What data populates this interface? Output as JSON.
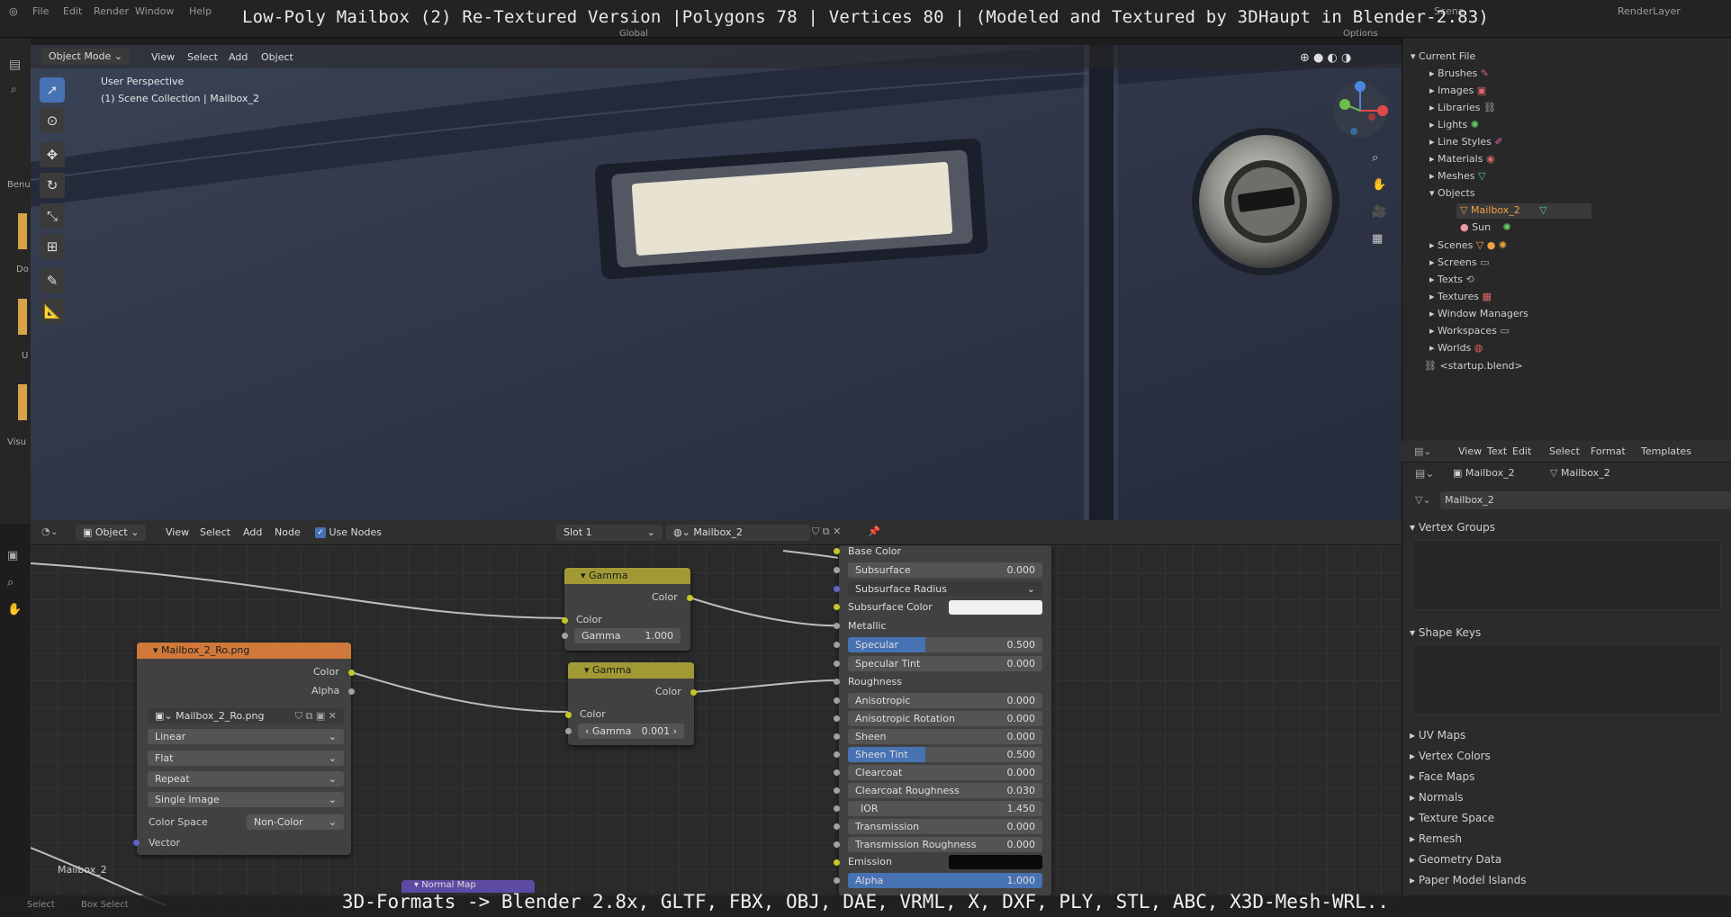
{
  "overlay_title": "Low-Poly Mailbox (2) Re-Textured Version |Polygons 78 | Vertices 80 | (Modeled and Textured by 3DHaupt in Blender-2.83)",
  "overlay_footer": "3D-Formats -> Blender 2.8x, GLTF, FBX, OBJ, DAE, VRML, X, DXF, PLY, STL, ABC, X3D-Mesh-WRL..",
  "topbar": {
    "menus": [
      "File",
      "Edit",
      "Render",
      "Window",
      "Help"
    ],
    "scene": "Scene",
    "render_layer": "RenderLayer",
    "options": "Options",
    "orientation": "Global"
  },
  "left_edge": {
    "labels": [
      "Benu",
      "Do",
      "U",
      "Visu"
    ]
  },
  "viewport": {
    "mode": "Object Mode",
    "menus": [
      "View",
      "Select",
      "Add",
      "Object"
    ],
    "overlay_line1": "User Perspective",
    "overlay_line2": "(1) Scene Collection | Mailbox_2"
  },
  "outliner": {
    "root": "Current File",
    "items": [
      "Brushes",
      "Images",
      "Libraries",
      "Lights",
      "Line Styles",
      "Materials",
      "Meshes",
      "Objects",
      "Scenes",
      "Screens",
      "Texts",
      "Textures",
      "Window Managers",
      "Workspaces",
      "Worlds"
    ],
    "objects_children": [
      "Mailbox_2",
      "Sun"
    ],
    "startup": "<startup.blend>"
  },
  "properties": {
    "menus": [
      "View",
      "Text",
      "Edit",
      "Select",
      "Format",
      "Templates"
    ],
    "object_name": "Mailbox_2",
    "mesh_name": "Mailbox_2",
    "data_name": "Mailbox_2",
    "panels_open": [
      "Vertex Groups",
      "Shape Keys"
    ],
    "panels_closed": [
      "UV Maps",
      "Vertex Colors",
      "Face Maps",
      "Normals",
      "Texture Space",
      "Remesh",
      "Geometry Data",
      "Paper Model Islands"
    ]
  },
  "node_editor": {
    "type": "Object",
    "menus": [
      "View",
      "Select",
      "Add",
      "Node"
    ],
    "use_nodes": "Use Nodes",
    "slot": "Slot 1",
    "material": "Mailbox_2",
    "image_node": {
      "title": "Mailbox_2_Ro.png",
      "out_color": "Color",
      "out_alpha": "Alpha",
      "image": "Mailbox_2_Ro.png",
      "interpolation": "Linear",
      "projection": "Flat",
      "extension": "Repeat",
      "source": "Single Image",
      "color_space_label": "Color Space",
      "color_space": "Non-Color",
      "vector": "Vector"
    },
    "gamma1": {
      "title": "Gamma",
      "out": "Color",
      "in": "Color",
      "gamma_label": "Gamma",
      "gamma_value": "1.000"
    },
    "gamma2": {
      "title": "Gamma",
      "out": "Color",
      "in": "Color",
      "gamma_label": "Gamma",
      "gamma_value": "0.001"
    },
    "floating_label": "Mailbox_2",
    "bottom_node": "Normal Map",
    "bsdf": {
      "base_color": "Base Color",
      "subsurface": {
        "label": "Subsurface",
        "value": "0.000"
      },
      "subsurface_radius": "Subsurface Radius",
      "subsurface_color": "Subsurface Color",
      "metallic": "Metallic",
      "specular": {
        "label": "Specular",
        "value": "0.500",
        "fill": 0.4
      },
      "specular_tint": {
        "label": "Specular Tint",
        "value": "0.000"
      },
      "roughness": "Roughness",
      "anisotropic": {
        "label": "Anisotropic",
        "value": "0.000"
      },
      "anisotropic_rotation": {
        "label": "Anisotropic Rotation",
        "value": "0.000"
      },
      "sheen": {
        "label": "Sheen",
        "value": "0.000"
      },
      "sheen_tint": {
        "label": "Sheen Tint",
        "value": "0.500",
        "fill": 0.4
      },
      "clearcoat": {
        "label": "Clearcoat",
        "value": "0.000"
      },
      "clearcoat_roughness": {
        "label": "Clearcoat Roughness",
        "value": "0.030"
      },
      "ior": {
        "label": "IOR",
        "value": "1.450"
      },
      "transmission": {
        "label": "Transmission",
        "value": "0.000"
      },
      "transmission_roughness": {
        "label": "Transmission Roughness",
        "value": "0.000"
      },
      "emission": "Emission",
      "alpha": {
        "label": "Alpha",
        "value": "1.000",
        "fill": 1.0
      }
    }
  },
  "bottom_bar": {
    "left": "Select",
    "left2": "Box Select"
  },
  "colors": {
    "accent": "#4772b3",
    "image_node": "#d1793a",
    "gamma_node": "#a19a34",
    "socket_yellow": "#c7c729",
    "socket_grey": "#a1a1a1",
    "socket_purple": "#6363c7"
  }
}
